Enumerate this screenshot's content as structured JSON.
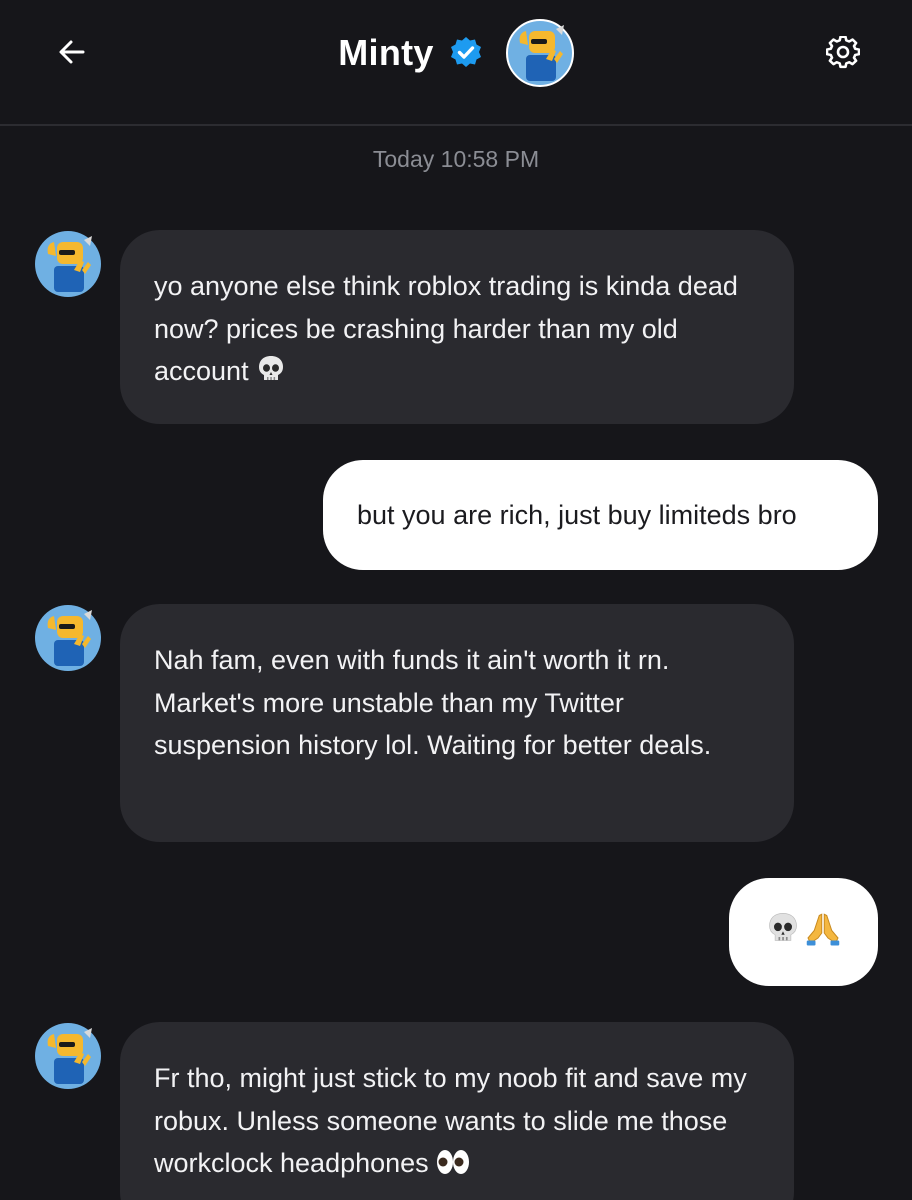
{
  "header": {
    "title": "Minty",
    "back_icon": "arrow-left-icon",
    "verified_icon": "verified-badge-icon",
    "settings_icon": "gear-icon"
  },
  "conversation": {
    "timestamp": "Today 10:58 PM",
    "messages": [
      {
        "direction": "incoming",
        "text": "yo anyone else think roblox trading is kinda dead now? prices be crashing harder than my old account",
        "emoji": "skull-emoji"
      },
      {
        "direction": "outgoing",
        "text": "but you are rich, just buy limiteds bro"
      },
      {
        "direction": "incoming",
        "text": "Nah fam, even with funds it ain't worth it rn. Market's more unstable than my Twitter suspension history lol. Waiting for better deals."
      },
      {
        "direction": "outgoing",
        "text": "💀🙏"
      },
      {
        "direction": "incoming",
        "text": "Fr tho, might just stick to my noob fit and save my robux. Unless someone wants to slide me those workclock headphones",
        "emoji": "eyes-emoji"
      }
    ]
  },
  "colors": {
    "background": "#16161a",
    "incoming_bubble": "#2a2a2f",
    "outgoing_bubble": "#ffffff",
    "verified_blue": "#1d9bf0",
    "timestamp": "#8b8d94"
  }
}
